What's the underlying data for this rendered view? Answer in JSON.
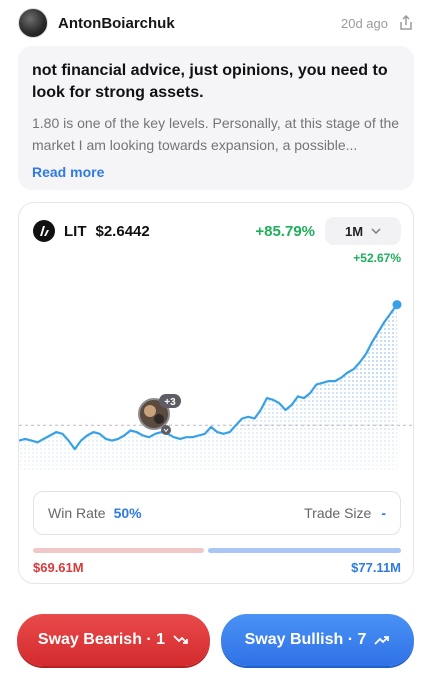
{
  "post": {
    "author": "AntonBoiarchuk",
    "time_ago": "20d ago",
    "title": "not financial advice, just opinions, you need to look for strong assets.",
    "body": "1.80 is one of the key levels. Personally, at this stage of the market I am looking towards expansion, a possible...",
    "read_more": "Read more"
  },
  "trade": {
    "symbol": "LIT",
    "price": "$2.6442",
    "change": "+85.79%",
    "period": "1M",
    "chart_change": "+52.67%",
    "avatar_count": "+3",
    "win_rate_label": "Win Rate",
    "win_rate_value": "50%",
    "trade_size_label": "Trade Size",
    "trade_size_value": "-",
    "bearish_amount": "$69.61M",
    "bullish_amount": "$77.11M",
    "bearish_share": 0.47,
    "colors": {
      "bull": "#2f7be0",
      "bear": "#d9393b",
      "line": "#3aa0e6",
      "up": "#1fae5c"
    }
  },
  "chart_data": {
    "type": "line",
    "y": [
      12,
      13,
      12,
      11,
      13,
      15,
      17,
      16,
      12,
      7,
      12,
      15,
      17,
      16,
      13,
      12,
      13,
      15,
      18,
      17,
      15,
      14,
      16,
      17,
      16,
      14,
      13,
      14,
      14,
      15,
      16,
      20,
      17,
      16,
      17,
      21,
      25,
      26,
      25,
      30,
      37,
      36,
      34,
      30,
      33,
      38,
      37,
      40,
      45,
      46,
      47,
      47,
      49,
      52,
      54,
      58,
      63,
      70,
      76,
      82,
      87,
      92
    ],
    "ylim": [
      0,
      100
    ]
  },
  "actions": {
    "bearish": "Sway Bearish · 1",
    "bullish": "Sway Bullish · 7"
  }
}
